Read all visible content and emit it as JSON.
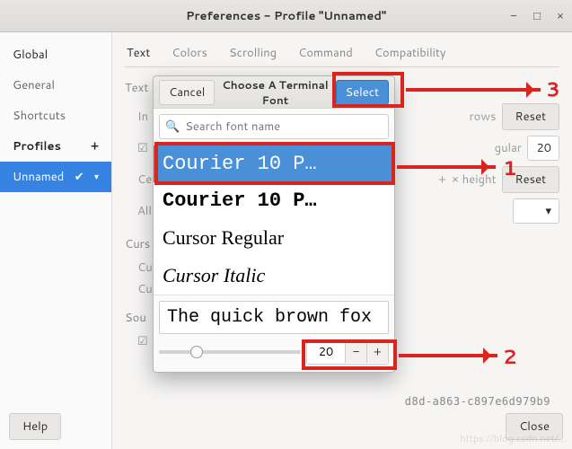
{
  "window": {
    "title": "Preferences - Profile \"Unnamed\""
  },
  "sidebar": {
    "global": "Global",
    "general": "General",
    "shortcuts": "Shortcuts",
    "profiles_header": "Profiles",
    "profiles_plus": "+",
    "active_profile": "Unnamed"
  },
  "tabs": {
    "text": "Text",
    "colors": "Colors",
    "scrolling": "Scrolling",
    "command": "Command",
    "compatibility": "Compatibility"
  },
  "text_section": {
    "appearance_header": "Text Appearance",
    "initial": "In",
    "custom_cb": "☑",
    "cell": "Ce",
    "allow": "All",
    "rows_lbl": "rows",
    "reset_btn": "Reset",
    "regular_lbl": "gular",
    "twenty": "20",
    "plus": "+",
    "xheight": "× height",
    "cursor_header": "Curs",
    "cursor_sub": "Cu",
    "sound_header": "Sou",
    "profile_id": "d8d-a863-c897e6d979b9"
  },
  "font_dialog": {
    "cancel": "Cancel",
    "title": "Choose A Terminal Font",
    "select": "Select",
    "search_placeholder": "Search font name",
    "fonts": {
      "courier10": "Courier 10 P…",
      "courier10b": "Courier 10 P…",
      "cursor_reg": "Cursor Regular",
      "cursor_it": "Cursor Italic"
    },
    "preview": "The quick brown fox",
    "size": "20",
    "minus": "−",
    "plus": "+"
  },
  "buttons": {
    "help": "Help",
    "close": "Close"
  },
  "annotations": {
    "n1": "1",
    "n2": "2",
    "n3": "3"
  },
  "watermark": "https://blog.csdn.net/..."
}
